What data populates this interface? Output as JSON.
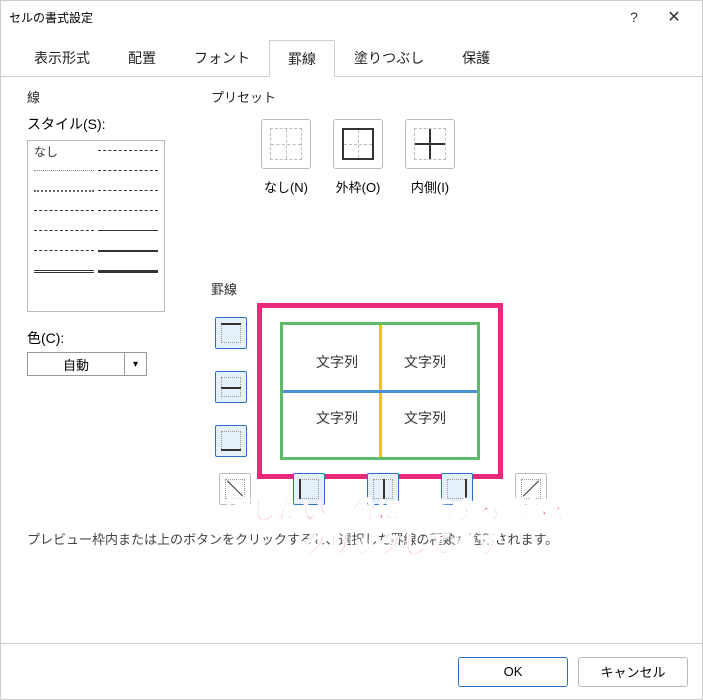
{
  "window": {
    "title": "セルの書式設定"
  },
  "tabs": {
    "format": "表示形式",
    "align": "配置",
    "font": "フォント",
    "border": "罫線",
    "fill": "塗りつぶし",
    "protect": "保護"
  },
  "line": {
    "group": "線",
    "style_label": "スタイル(S):",
    "none": "なし",
    "color_label": "色(C):",
    "color_value": "自動"
  },
  "presets": {
    "group": "プリセット",
    "none": "なし(N)",
    "outline": "外枠(O)",
    "inside": "内側(I)"
  },
  "border": {
    "group": "罫線",
    "cell_text": "文字列"
  },
  "hint": "プレビュー枠内または上のボタンをクリックすると、選択した罫線の種類が適用されます。",
  "overlay": {
    "line1": "消したい部分に対応する罫線を",
    "line2": "クリックして消す"
  },
  "buttons": {
    "ok": "OK",
    "cancel": "キャンセル"
  }
}
